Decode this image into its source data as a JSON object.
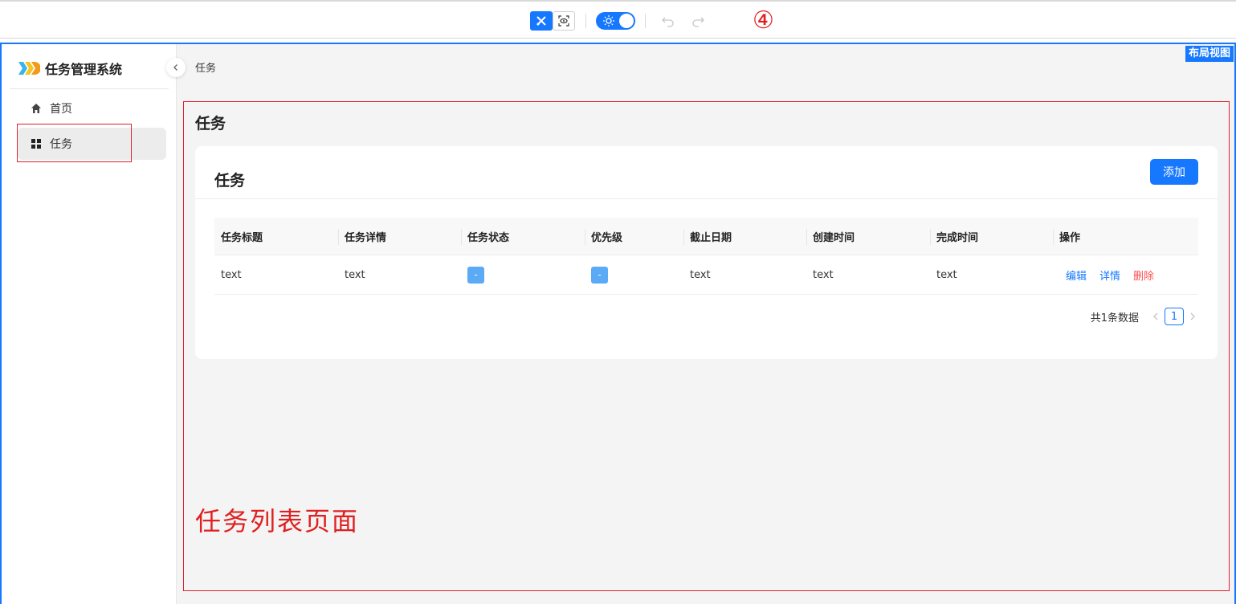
{
  "toolbar": {
    "step_marker": "④",
    "design_mode_icon": "design-tools-icon",
    "preview_icon": "preview-eye-icon",
    "theme_icon": "sun-icon",
    "undo_icon": "undo-icon",
    "redo_icon": "redo-icon",
    "accent_color": "#1677ff"
  },
  "frame": {
    "layout_badge": "布局视图"
  },
  "sidebar": {
    "app_title": "任务管理系统",
    "logo_icon": "app-logo-icon",
    "items": [
      {
        "label": "首页",
        "icon": "home-icon",
        "selected": false
      },
      {
        "label": "任务",
        "icon": "grid-icon",
        "selected": true
      }
    ]
  },
  "breadcrumb": {
    "current": "任务"
  },
  "page": {
    "title": "任务",
    "annotation": "任务列表页面"
  },
  "card": {
    "title": "任务",
    "add_button": "添加"
  },
  "table": {
    "columns": [
      "任务标题",
      "任务详情",
      "任务状态",
      "优先级",
      "截止日期",
      "创建时间",
      "完成时间",
      "操作"
    ],
    "rows": [
      {
        "title": "text",
        "detail": "text",
        "status": "-",
        "priority": "-",
        "deadline": "text",
        "created": "text",
        "completed": "text",
        "actions": {
          "edit": "编辑",
          "detail": "详情",
          "delete": "删除"
        }
      }
    ]
  },
  "pagination": {
    "total_text": "共1条数据",
    "current_page": "1",
    "prev_icon": "chevron-left-icon",
    "next_icon": "chevron-right-icon"
  },
  "colors": {
    "primary": "#1677ff",
    "danger": "#ff4d4f",
    "annotation_red": "#e02020",
    "tag_blue": "#5aaaf6"
  }
}
